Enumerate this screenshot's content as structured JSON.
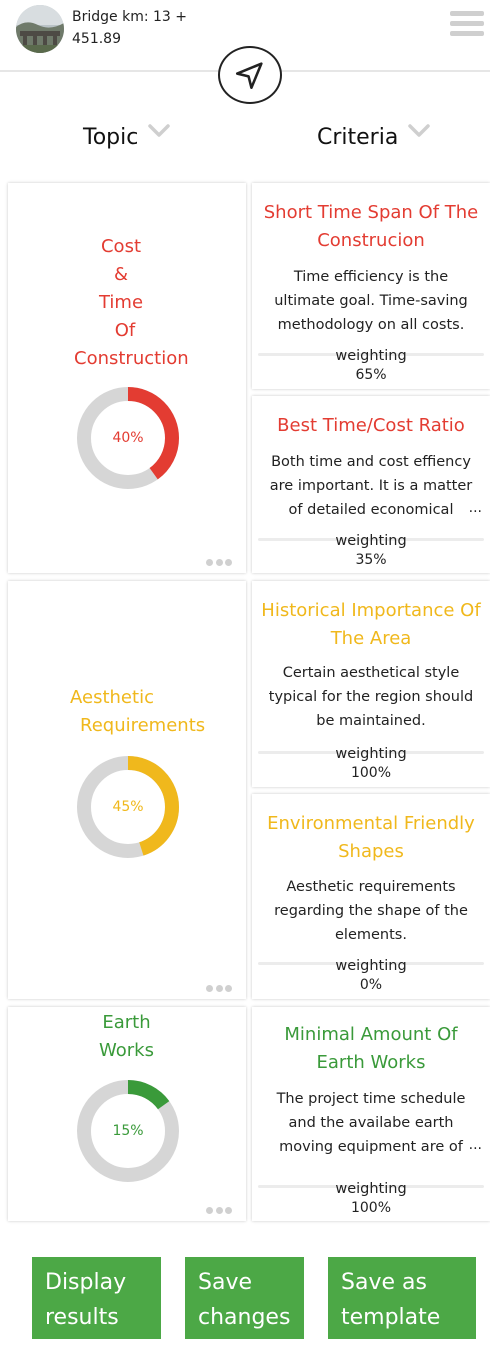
{
  "header": {
    "title": "Bridge km: 13 + 451.89",
    "menu_icon": "hamburger-menu-icon",
    "nav_icon": "navigation-arrow-icon"
  },
  "columns": {
    "topic": "Topic",
    "criteria": "Criteria"
  },
  "colors": {
    "red": "#e33c32",
    "yellow": "#f0b81c",
    "green": "#3a9a3a",
    "donut_track": "#d6d6d6",
    "button_green": "#4ca846"
  },
  "topics": [
    {
      "title": "Cost & Time Of Construction",
      "percent": "40%",
      "fraction": 0.4,
      "color": "#e33c32",
      "criteria": [
        {
          "title": "Short Time Span Of The Construcion",
          "desc": "Time efficiency is the ultimate goal. Time-saving methodology on all costs.",
          "weight_label": "weighting",
          "weight": "65%",
          "truncated": false
        },
        {
          "title": "Best Time/Cost Ratio",
          "desc": "Both time and cost effiency are important. It is a matter of detailed economical",
          "weight_label": "weighting",
          "weight": "35%",
          "truncated": true
        }
      ]
    },
    {
      "title": "Aesthetic Requirements",
      "percent": "45%",
      "fraction": 0.45,
      "color": "#f0b81c",
      "criteria": [
        {
          "title": "Historical Importance Of The Area",
          "desc": "Certain aesthetical style typical for the region should be maintained.",
          "weight_label": "weighting",
          "weight": "100%",
          "truncated": false
        },
        {
          "title": "Environmental Friendly Shapes",
          "desc": "Aesthetic requirements regarding the shape of the elements.",
          "weight_label": "weighting",
          "weight": "0%",
          "truncated": false
        }
      ]
    },
    {
      "title": "Earth Works",
      "percent": "15%",
      "fraction": 0.15,
      "color": "#3a9a3a",
      "criteria": [
        {
          "title": "Minimal Amount Of Earth Works",
          "desc": "The project time schedule and the availabe earth moving equipment are of",
          "weight_label": "weighting",
          "weight": "100%",
          "truncated": true
        }
      ]
    }
  ],
  "ellipsis": "...",
  "buttons": {
    "display": "Display results",
    "save": "Save changes",
    "template": "Save as template"
  }
}
